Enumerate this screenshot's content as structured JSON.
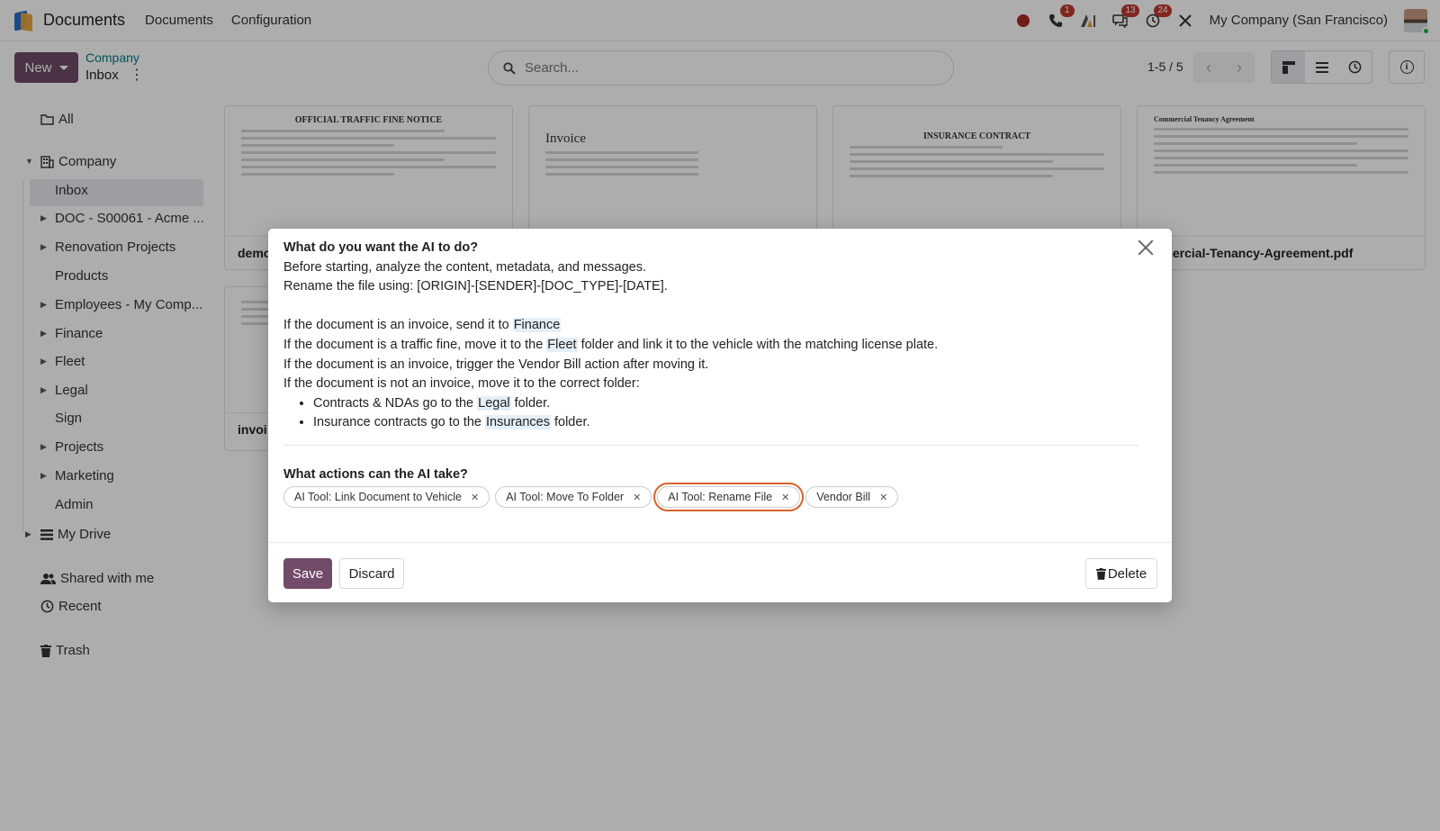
{
  "navbar": {
    "app_name": "Documents",
    "menus": [
      "Documents",
      "Configuration"
    ],
    "phone_badge": "1",
    "messages_badge": "13",
    "activity_badge": "24",
    "company": "My Company (San Francisco)"
  },
  "control_panel": {
    "new_label": "New",
    "breadcrumb_parent": "Company",
    "breadcrumb_current": "Inbox",
    "search_placeholder": "Search...",
    "pager": "1-5 / 5"
  },
  "sidebar": {
    "all": "All",
    "company": "Company",
    "children": [
      "Inbox",
      "DOC - S00061 - Acme ...",
      "Renovation Projects",
      "Products",
      "Employees - My Comp...",
      "Finance",
      "Fleet",
      "Legal",
      "Sign",
      "Projects",
      "Marketing",
      "Admin"
    ],
    "my_drive": "My Drive",
    "shared": "Shared with me",
    "recent": "Recent",
    "trash": "Trash"
  },
  "cards": {
    "c1_title": "OFFICIAL TRAFFIC FINE NOTICE",
    "c1_name": "demo",
    "c2_title": "Invoice",
    "c3_title": "INSURANCE CONTRACT",
    "c4_title": "Commercial Tenancy Agreement",
    "c4_name": "mmercial-Tenancy-Agreement.pdf",
    "c5_name": "invoi"
  },
  "dialog": {
    "q1": "What do you want the AI to do?",
    "line1": "Before starting, analyze the content, metadata, and messages.",
    "line2": "Rename the file using: [ORIGIN]-[SENDER]-[DOC_TYPE]-[DATE].",
    "r1_pre": "If the document is an invoice, send it to ",
    "r1_link": "Finance",
    "r2_pre": "If the document is a traffic fine, move it to the ",
    "r2_link": "Fleet",
    "r2_post": " folder and link it to the vehicle with the matching license plate.",
    "r3": "If the document is an invoice, trigger the Vendor Bill action after moving it.",
    "r4": "If the document is not an invoice, move it to the correct folder:",
    "b1_pre": "Contracts & NDAs go to the ",
    "b1_link": "Legal",
    "b1_post": " folder.",
    "b2_pre": "Insurance contracts go to the ",
    "b2_link": "Insurances",
    "b2_post": " folder.",
    "q2": "What actions can the AI take?",
    "tags": [
      "AI Tool: Link Document to Vehicle",
      "AI Tool: Move To Folder",
      "AI Tool: Rename File",
      "Vendor Bill"
    ],
    "save": "Save",
    "discard": "Discard",
    "delete": "Delete"
  },
  "colors": {
    "brand": "#714b67",
    "link": "#017e84",
    "focus": "#d9622b"
  }
}
